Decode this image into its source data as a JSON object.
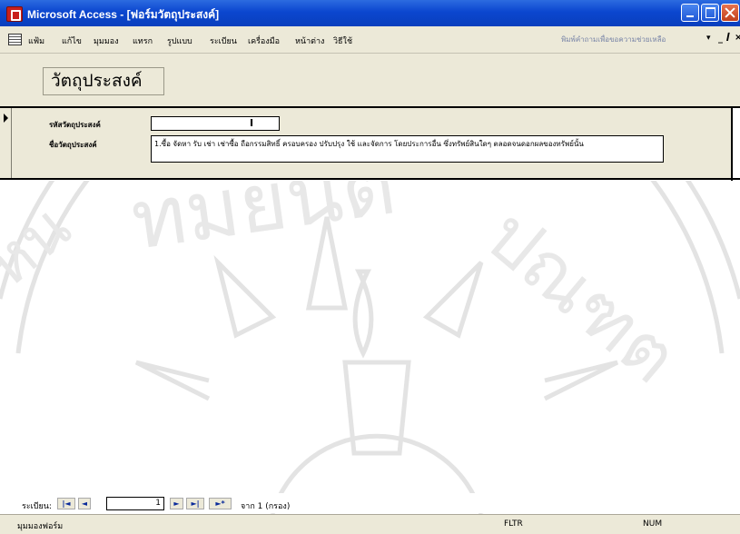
{
  "window": {
    "title": "Microsoft Access - [ฟอร์มวัตถุประสงค์]"
  },
  "menu": {
    "items": [
      "แฟ้ม",
      "แก้ไข",
      "มุมมอง",
      "แทรก",
      "รูปแบบ",
      "ระเบียน",
      "เครื่องมือ",
      "หน้าต่าง",
      "วิธีใช้"
    ],
    "help_placeholder": "พิมพ์คำถามเพื่อขอความช่วยเหลือ"
  },
  "form": {
    "title": "วัตถุประสงค์",
    "fields": [
      {
        "label": "รหัสวัตถุประสงค์",
        "value": ""
      },
      {
        "label": "ชื่อวัตถุประสงค์",
        "value": "1.ซื้อ จัดหา รับ เช่า เช่าซื้อ ถือกรรมสิทธิ์ ครอบครอง ปรับปรุง ใช้ และจัดการ โดยประการอื่น ซึ่งทรัพย์สินใดๆ ตลอดจนดอกผลของทรัพย์นั้น"
      }
    ]
  },
  "navigation": {
    "label": "ระเบียน:",
    "first": "|◄",
    "prev": "◄",
    "current": "1",
    "next": "►",
    "last": "►|",
    "new": "►*",
    "of_text": "จาก 1 (กรอง)"
  },
  "status": {
    "text": "มุมมองฟอร์ม",
    "filter": "FLTR",
    "num": "NUM"
  },
  "watermark": {
    "top_text": "ทมยนต",
    "right_text": "ปณฑต",
    "left_text": "หน"
  }
}
